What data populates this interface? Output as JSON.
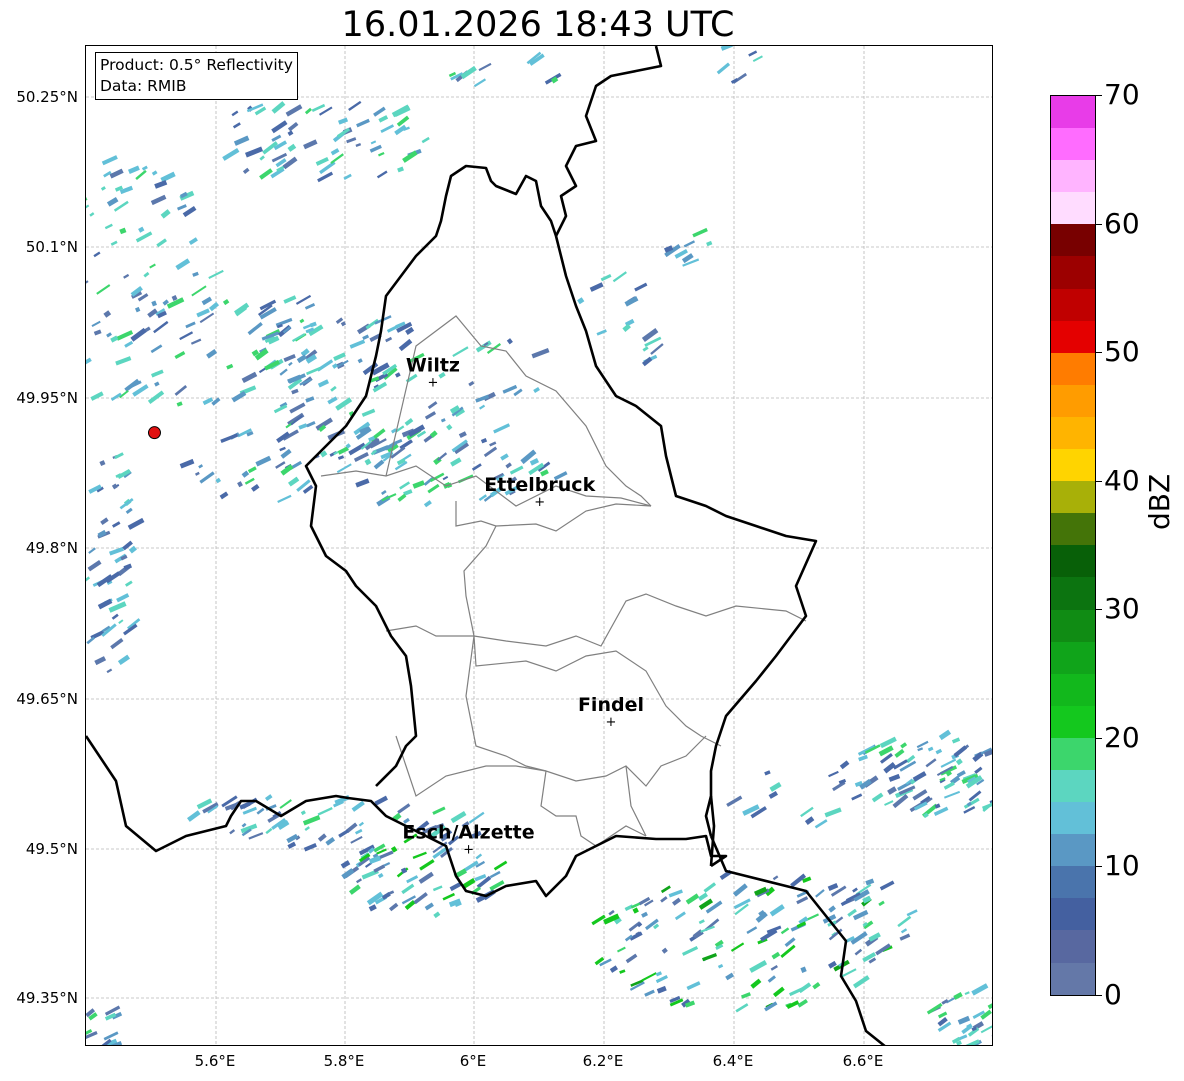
{
  "title": "16.01.2026 18:43 UTC",
  "info": {
    "product": "Product: 0.5° Reflectivity",
    "data_source": "Data: RMIB"
  },
  "lat_labels": [
    "50.25°N",
    "50.1°N",
    "49.95°N",
    "49.8°N",
    "49.65°N",
    "49.5°N",
    "49.35°N"
  ],
  "lon_labels": [
    "5.6°E",
    "5.8°E",
    "6°E",
    "6.2°E",
    "6.4°E",
    "6.6°E"
  ],
  "cities": [
    {
      "name": "Wiltz",
      "lon": 5.935,
      "lat": 49.966
    },
    {
      "name": "Ettelbruck",
      "lon": 6.1,
      "lat": 49.847
    },
    {
      "name": "Findel",
      "lon": 6.21,
      "lat": 49.627
    },
    {
      "name": "Esch/Alzette",
      "lon": 5.99,
      "lat": 49.5
    }
  ],
  "radar_site": {
    "lon": 5.505,
    "lat": 49.915
  },
  "colorbar": {
    "label": "dBZ",
    "tick_labels": [
      "0",
      "10",
      "20",
      "30",
      "40",
      "50",
      "60",
      "70"
    ],
    "min": 0,
    "max": 70,
    "colors": [
      "#6478a8",
      "#5868a0",
      "#4460a0",
      "#4a74ac",
      "#5a98c4",
      "#62c0d8",
      "#5cd6c0",
      "#3cd66c",
      "#14c81e",
      "#12b81c",
      "#10a41a",
      "#108c14",
      "#0c7410",
      "#086008",
      "#447408",
      "#a8b008",
      "#ffd400",
      "#ffb400",
      "#ff9c00",
      "#ff7c00",
      "#e40000",
      "#c00000",
      "#9c0000",
      "#780000",
      "#ffdcff",
      "#ffb4ff",
      "#ff6cff",
      "#e83ce8"
    ]
  }
}
